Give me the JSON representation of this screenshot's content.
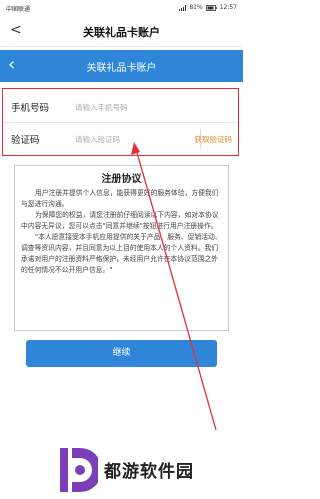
{
  "status_bar": {
    "carrier": "中国联通",
    "battery": "81%",
    "time": "12:57"
  },
  "outer_header": {
    "back_glyph": "<",
    "title": "关联礼品卡账户"
  },
  "inner_header": {
    "back_glyph": "‹",
    "title": "关联礼品卡账户"
  },
  "form": {
    "phone_label": "手机号码",
    "phone_placeholder": "请输入手机号码",
    "code_label": "验证码",
    "code_placeholder": "请输入验证码",
    "get_code_button": "获取验证码"
  },
  "agreement": {
    "title": "注册协议",
    "paragraphs": [
      "用户注册并提供个人信息，能获得更好的服务体验，方便我们与您进行沟通。",
      "为保障您的权益，请您注册前仔细阅读以下内容，如对本协议中内容无异议，您可以点击\"同意并继续\"按钮进行用户注册操作。",
      "\"本人愿意接受本手机应用提供的关于产品、服务、促销活动、调查等资讯内容，并且同意为以上目的使用本人的个人资料。我们承诺对用户的注册资料严格保护，未经用户允许在本协议范围之外的任何情况不公开用户信息。\""
    ]
  },
  "continue_button": "继续",
  "watermark": {
    "text": "都游软件园",
    "logo_color": "#7b3fb7"
  },
  "colors": {
    "brand_blue": "#2f86d8",
    "highlight_red": "#e0303a",
    "code_orange": "#e08a2e"
  }
}
